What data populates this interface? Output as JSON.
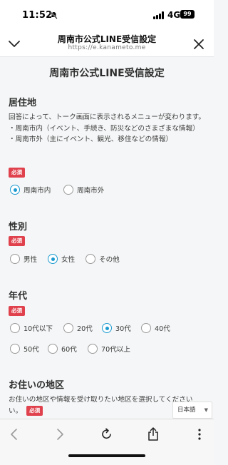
{
  "status_bar": {
    "time": "11:52",
    "network": "4G",
    "battery": "99"
  },
  "header": {
    "title": "周南市公式LINE受信設定",
    "url": "https://e.kanameto.me"
  },
  "form": {
    "title": "周南市公式LINE受信設定",
    "required_label": "必須",
    "residence": {
      "heading": "居住地",
      "description_1": "回答によって、トーク画面に表示されるメニューが変わります。",
      "description_2": "・周南市内（イベント、手続き、防災などのさまざまな情報）",
      "description_3": "・周南市外（主にイベント、観光、移住などの情報）",
      "options": [
        "周南市内",
        "周南市外"
      ],
      "selected": "周南市内"
    },
    "gender": {
      "heading": "性別",
      "options": [
        "男性",
        "女性",
        "その他"
      ],
      "selected": "女性"
    },
    "age": {
      "heading": "年代",
      "options": [
        "10代以下",
        "20代",
        "30代",
        "40代",
        "50代",
        "60代",
        "70代以上"
      ],
      "selected": "30代"
    },
    "area": {
      "heading": "お住いの地区",
      "description_1": "お住いの地区や情報を受け取りたい地区を選択してください",
      "description_2": "い。"
    }
  },
  "language_select": {
    "value": "日本語"
  },
  "colors": {
    "accent": "#1d9bd1",
    "required_badge": "#e0424d",
    "page_bg": "#f5f6f7"
  },
  "icons": [
    "chevron-down-icon",
    "close-icon",
    "back-icon",
    "forward-icon",
    "reload-icon",
    "share-icon",
    "more-icon",
    "bell-slash-icon",
    "signal-icon",
    "battery-icon"
  ]
}
